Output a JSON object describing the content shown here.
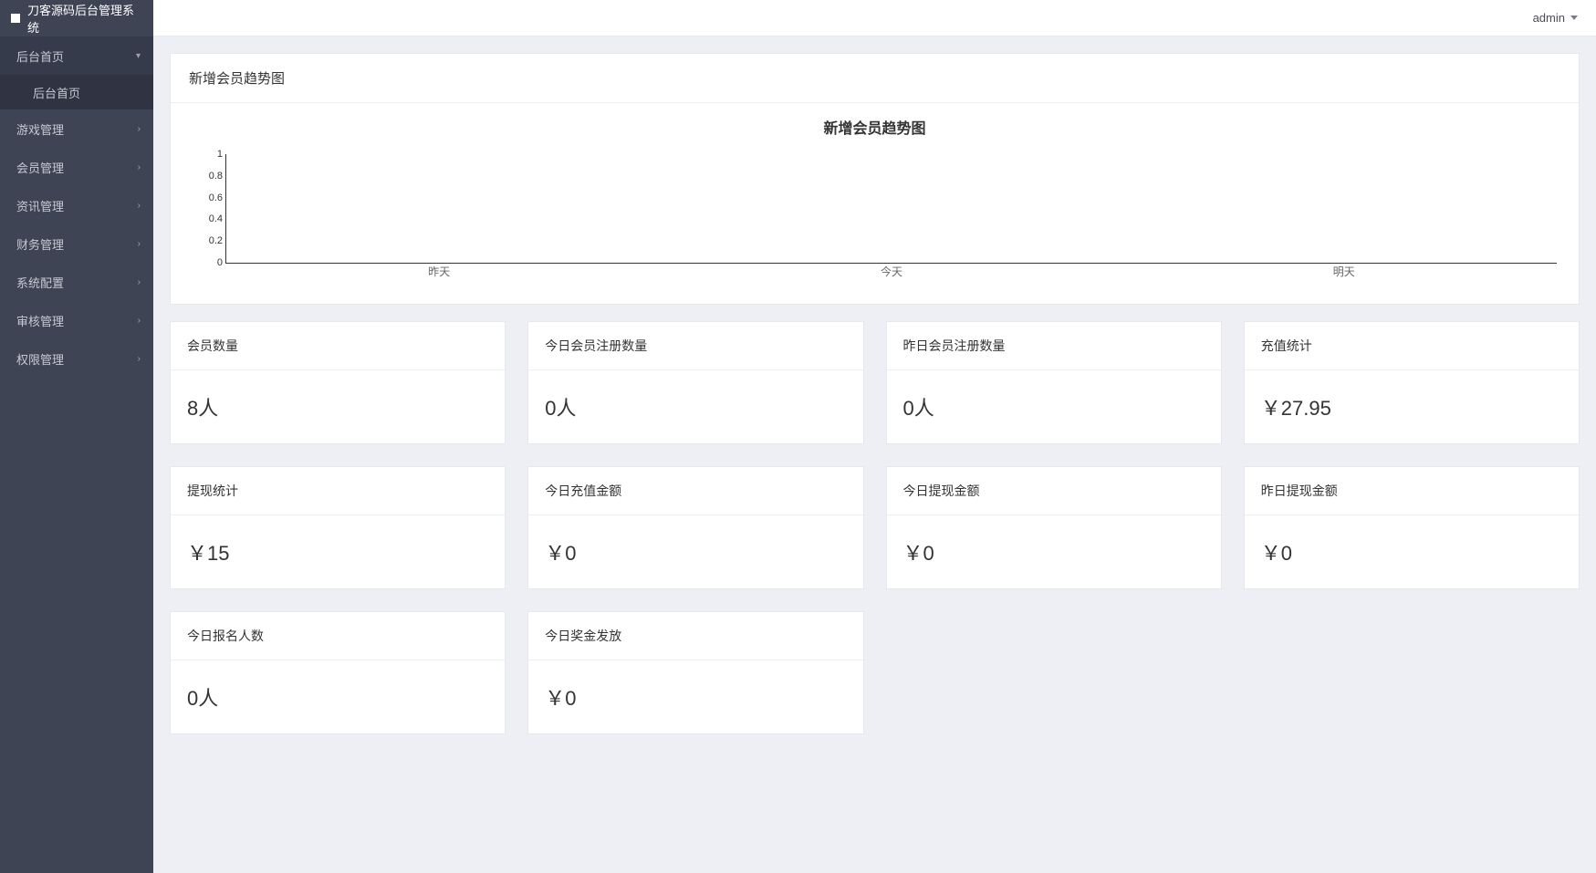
{
  "brand": "刀客源码后台管理系统",
  "user": "admin",
  "nav": [
    {
      "label": "后台首页",
      "chev": "down",
      "active": true
    },
    {
      "label": "游戏管理",
      "chev": "right"
    },
    {
      "label": "会员管理",
      "chev": "right"
    },
    {
      "label": "资讯管理",
      "chev": "right"
    },
    {
      "label": "财务管理",
      "chev": "right"
    },
    {
      "label": "系统配置",
      "chev": "right"
    },
    {
      "label": "审核管理",
      "chev": "right"
    },
    {
      "label": "权限管理",
      "chev": "right"
    }
  ],
  "nav_sub": "后台首页",
  "chart_panel_title": "新增会员趋势图",
  "chart_data": {
    "type": "line",
    "title": "新增会员趋势图",
    "categories": [
      "昨天",
      "今天",
      "明天"
    ],
    "values": [
      0,
      0,
      0
    ],
    "yticks": [
      "0",
      "0.2",
      "0.4",
      "0.6",
      "0.8",
      "1"
    ],
    "ylim": [
      0,
      1
    ],
    "xlabel": "",
    "ylabel": ""
  },
  "cards": [
    {
      "title": "会员数量",
      "value": "8人"
    },
    {
      "title": "今日会员注册数量",
      "value": "0人"
    },
    {
      "title": "昨日会员注册数量",
      "value": "0人"
    },
    {
      "title": "充值统计",
      "value": "￥27.95"
    },
    {
      "title": "提现统计",
      "value": "￥15"
    },
    {
      "title": "今日充值金额",
      "value": "￥0"
    },
    {
      "title": "今日提现金额",
      "value": "￥0"
    },
    {
      "title": "昨日提现金额",
      "value": "￥0"
    },
    {
      "title": "今日报名人数",
      "value": "0人"
    },
    {
      "title": "今日奖金发放",
      "value": "￥0"
    }
  ]
}
